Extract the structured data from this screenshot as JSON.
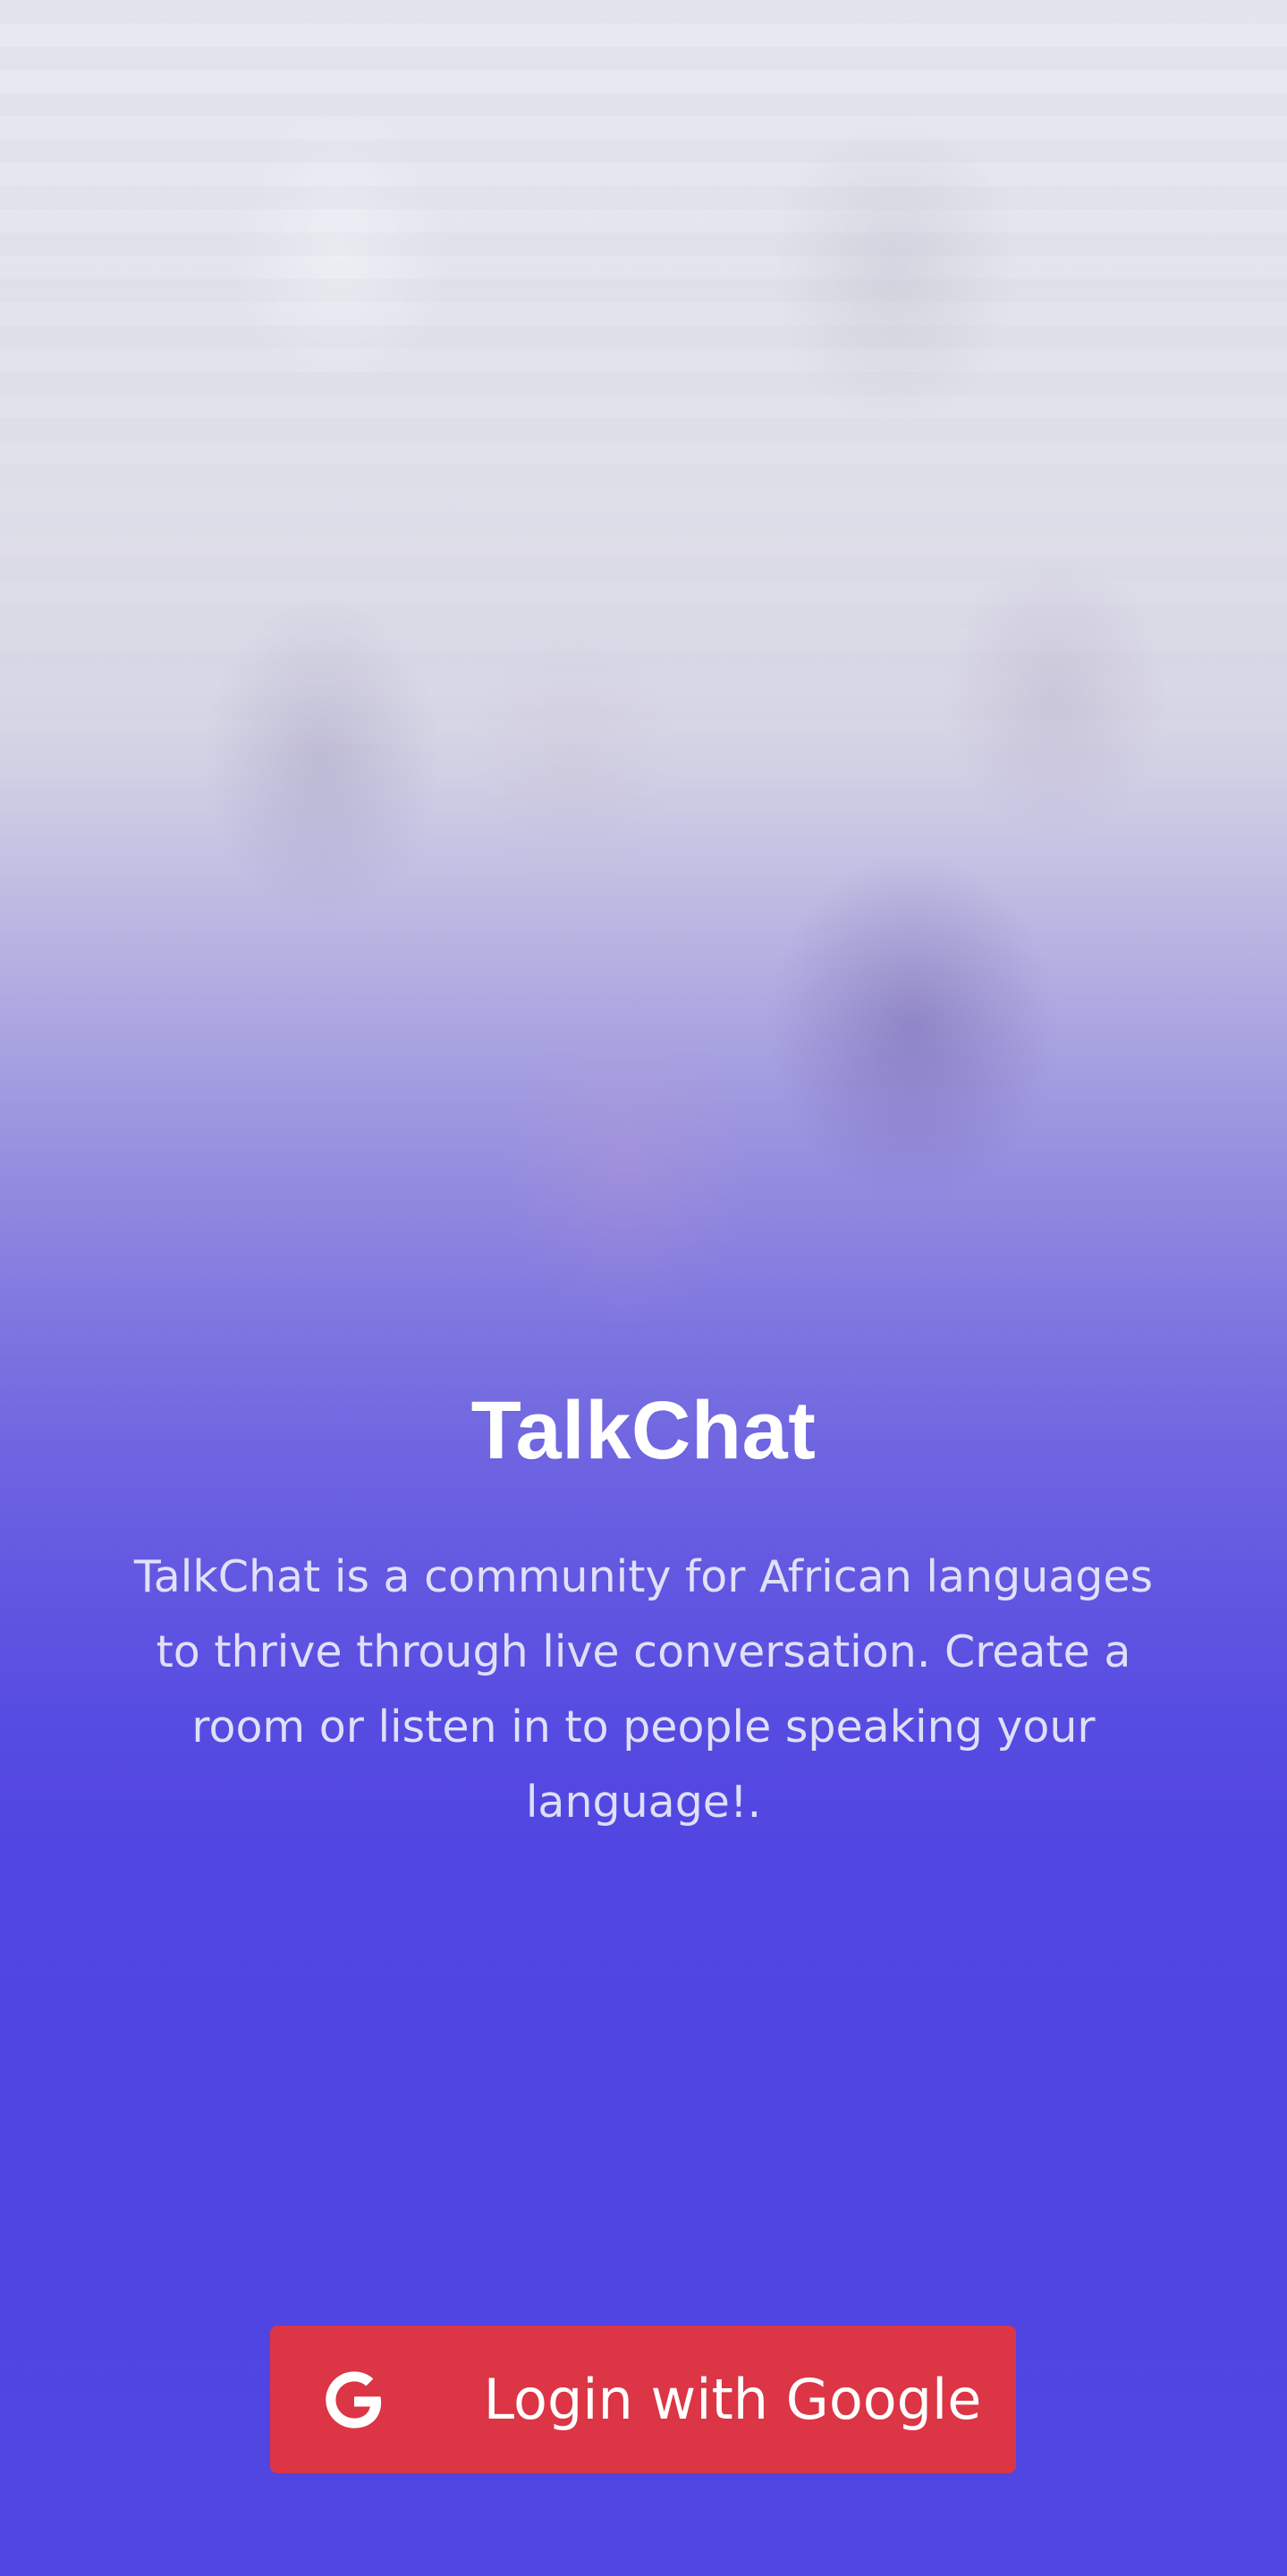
{
  "app": {
    "title": "TalkChat",
    "description": "TalkChat is a community for African languages to thrive through live conversation. Create a room or listen in to people speaking your language!."
  },
  "login": {
    "button_label": "Login with Google",
    "icon": "google-icon",
    "button_color": "#dc3545"
  },
  "theme": {
    "accent": "#4f43e2",
    "overlay_top": "#e6e6ee"
  }
}
